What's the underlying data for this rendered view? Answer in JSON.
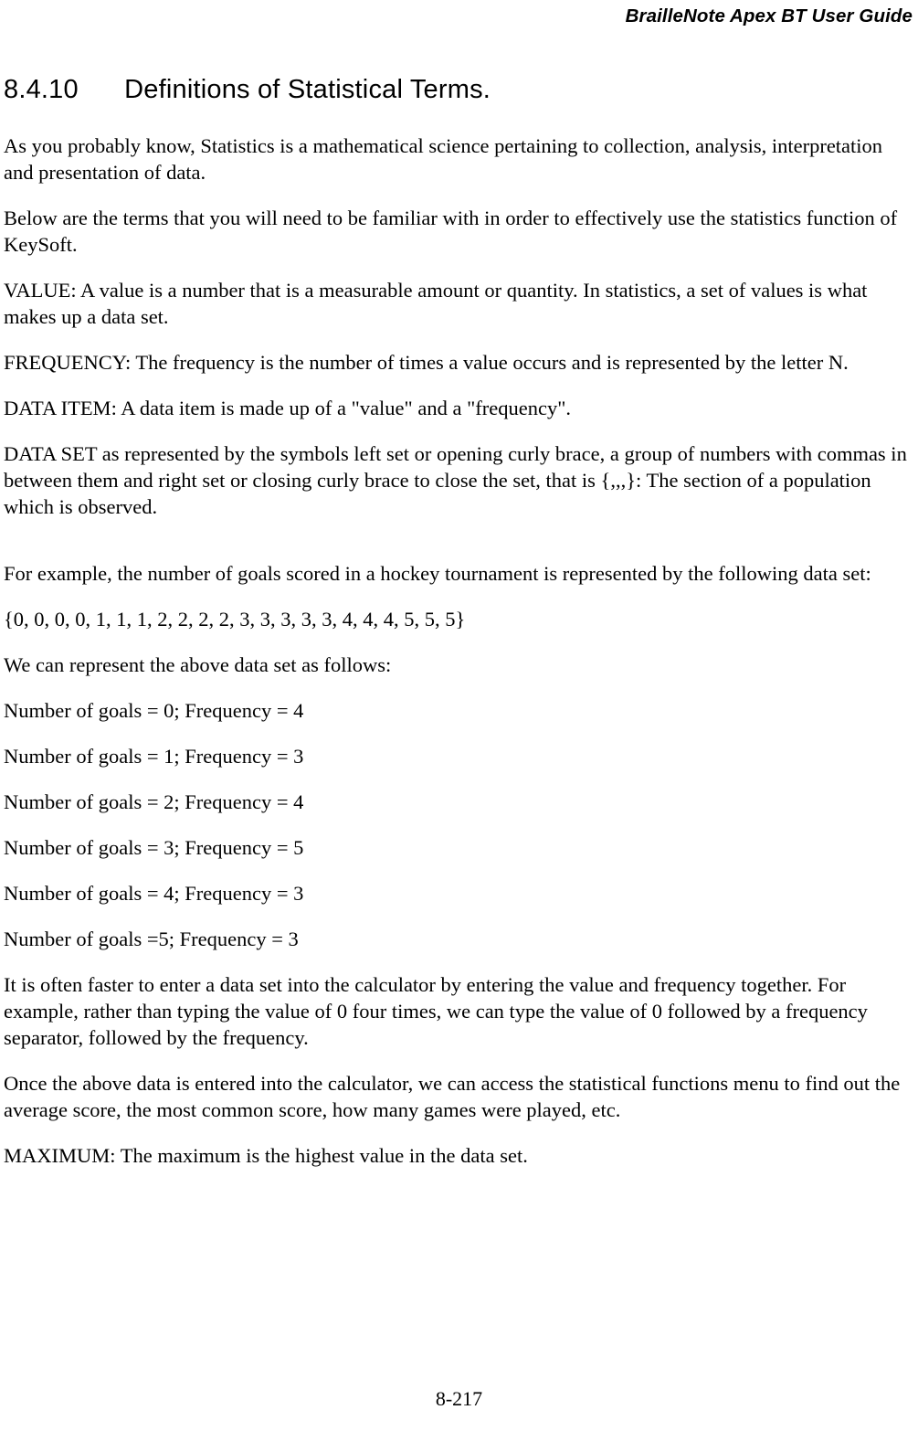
{
  "header": {
    "title": "BrailleNote Apex BT User Guide"
  },
  "heading": {
    "number": "8.4.10",
    "title": "Definitions of Statistical Terms.",
    "full": "8.4.10\tDefinitions of Statistical Terms."
  },
  "paragraphs": [
    "As you probably know, Statistics is a mathematical science pertaining to collection, analysis, interpretation and presentation of data.",
    "Below are the terms that you will need to be familiar with in order to effectively use the statistics function of KeySoft.",
    "VALUE: A value is a number that is a measurable amount or quantity. In statistics, a set of values is what makes up a data set.",
    "FREQUENCY: The frequency is the number of times a value occurs and is represented by the letter N.",
    "DATA ITEM: A data item is made up of a \"value\" and a \"frequency\".",
    "DATA SET as represented by the symbols left set or opening curly brace, a group of numbers with commas in between them and right set or closing curly brace to close the set, that is {,,,}: The section of a population which is observed.",
    "For example, the number of goals scored in a hockey tournament is represented by the following data set:",
    "{0, 0, 0, 0, 1, 1, 1, 2, 2, 2, 2, 3, 3, 3, 3, 3, 4, 4, 4, 5, 5, 5}",
    "We can represent the above data set as follows:",
    "Number of goals = 0; Frequency = 4",
    "Number of goals = 1; Frequency = 3",
    "Number of goals = 2; Frequency = 4",
    "Number of goals = 3; Frequency = 5",
    "Number of goals = 4; Frequency = 3",
    "Number of goals =5; Frequency = 3",
    "It is often faster to enter a data set into the calculator by entering the value and frequency together. For example, rather than typing the value of 0 four times, we can type the value of 0 followed by a frequency separator, followed by the frequency.",
    "Once the above data is entered into the calculator, we can access the statistical functions menu to find out the average score, the most common score, how many games were played, etc.",
    "MAXIMUM: The maximum is the highest value in the data set."
  ],
  "footer": {
    "page_number": "8-217"
  }
}
